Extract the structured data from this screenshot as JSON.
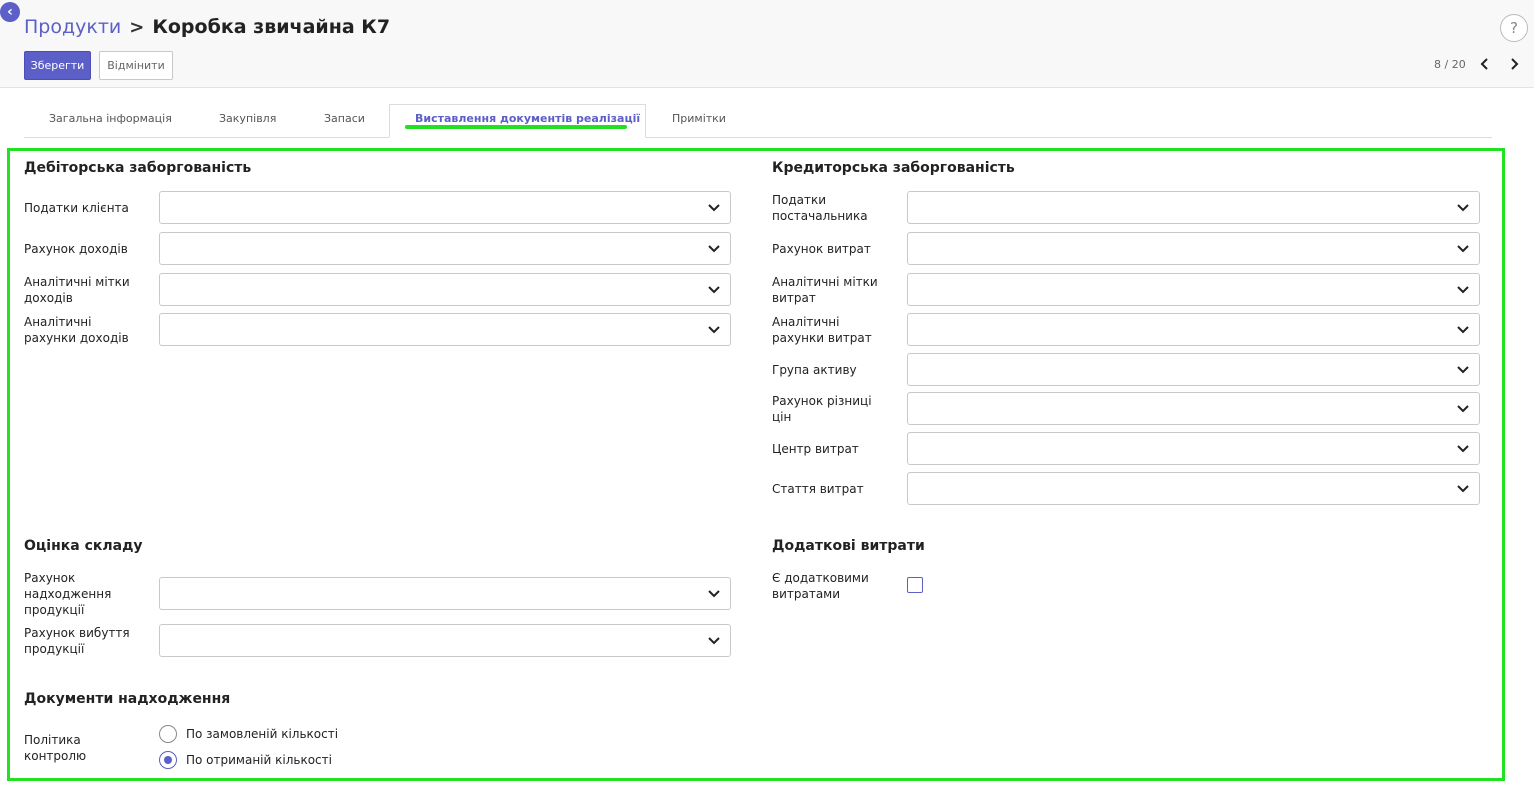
{
  "header": {
    "breadcrumb_parent": "Продукти",
    "breadcrumb_separator": ">",
    "breadcrumb_current": "Коробка звичайна К7",
    "save_label": "Зберегти",
    "discard_label": "Відмінити",
    "help_label": "?",
    "pager": "8 / 20",
    "pager_prev": "‹",
    "pager_next": "›"
  },
  "tabs": [
    {
      "label": "Загальна інформація"
    },
    {
      "label": "Закупівля"
    },
    {
      "label": "Запаси"
    },
    {
      "label": "Виставлення документів реалізації",
      "active": true
    },
    {
      "label": "Примітки"
    }
  ],
  "receivable": {
    "title": "Дебіторська заборгованість",
    "fields": [
      {
        "label": "Податки клієнта",
        "value": ""
      },
      {
        "label": "Рахунок доходів",
        "value": ""
      },
      {
        "label": "Аналітичні мітки доходів",
        "value": ""
      },
      {
        "label": "Аналітичні рахунки доходів",
        "value": ""
      }
    ]
  },
  "payable": {
    "title": "Кредиторська заборгованість",
    "fields": [
      {
        "label": "Податки постачальника",
        "value": ""
      },
      {
        "label": "Рахунок витрат",
        "value": ""
      },
      {
        "label": "Аналітичні мітки витрат",
        "value": ""
      },
      {
        "label": "Аналітичні рахунки витрат",
        "value": ""
      },
      {
        "label": "Група активу",
        "value": ""
      },
      {
        "label": "Рахунок різниці цін",
        "value": ""
      },
      {
        "label": "Центр витрат",
        "value": ""
      },
      {
        "label": "Стаття витрат",
        "value": ""
      }
    ]
  },
  "valuation": {
    "title": "Оцінка складу",
    "fields": [
      {
        "label": "Рахунок надходження продукції",
        "value": ""
      },
      {
        "label": "Рахунок вибуття продукції",
        "value": ""
      }
    ]
  },
  "landed_costs": {
    "title": "Додаткові витрати",
    "checkbox_label": "Є додатковими витратами",
    "checked": false
  },
  "receipts": {
    "title": "Документи надходження",
    "policy_label": "Політика контролю",
    "options": [
      {
        "label": "По замовленій кількості",
        "selected": false
      },
      {
        "label": "По отриманій кількості",
        "selected": true
      }
    ]
  },
  "colors": {
    "accent": "#5b5fc7",
    "highlight": "#22e022"
  }
}
